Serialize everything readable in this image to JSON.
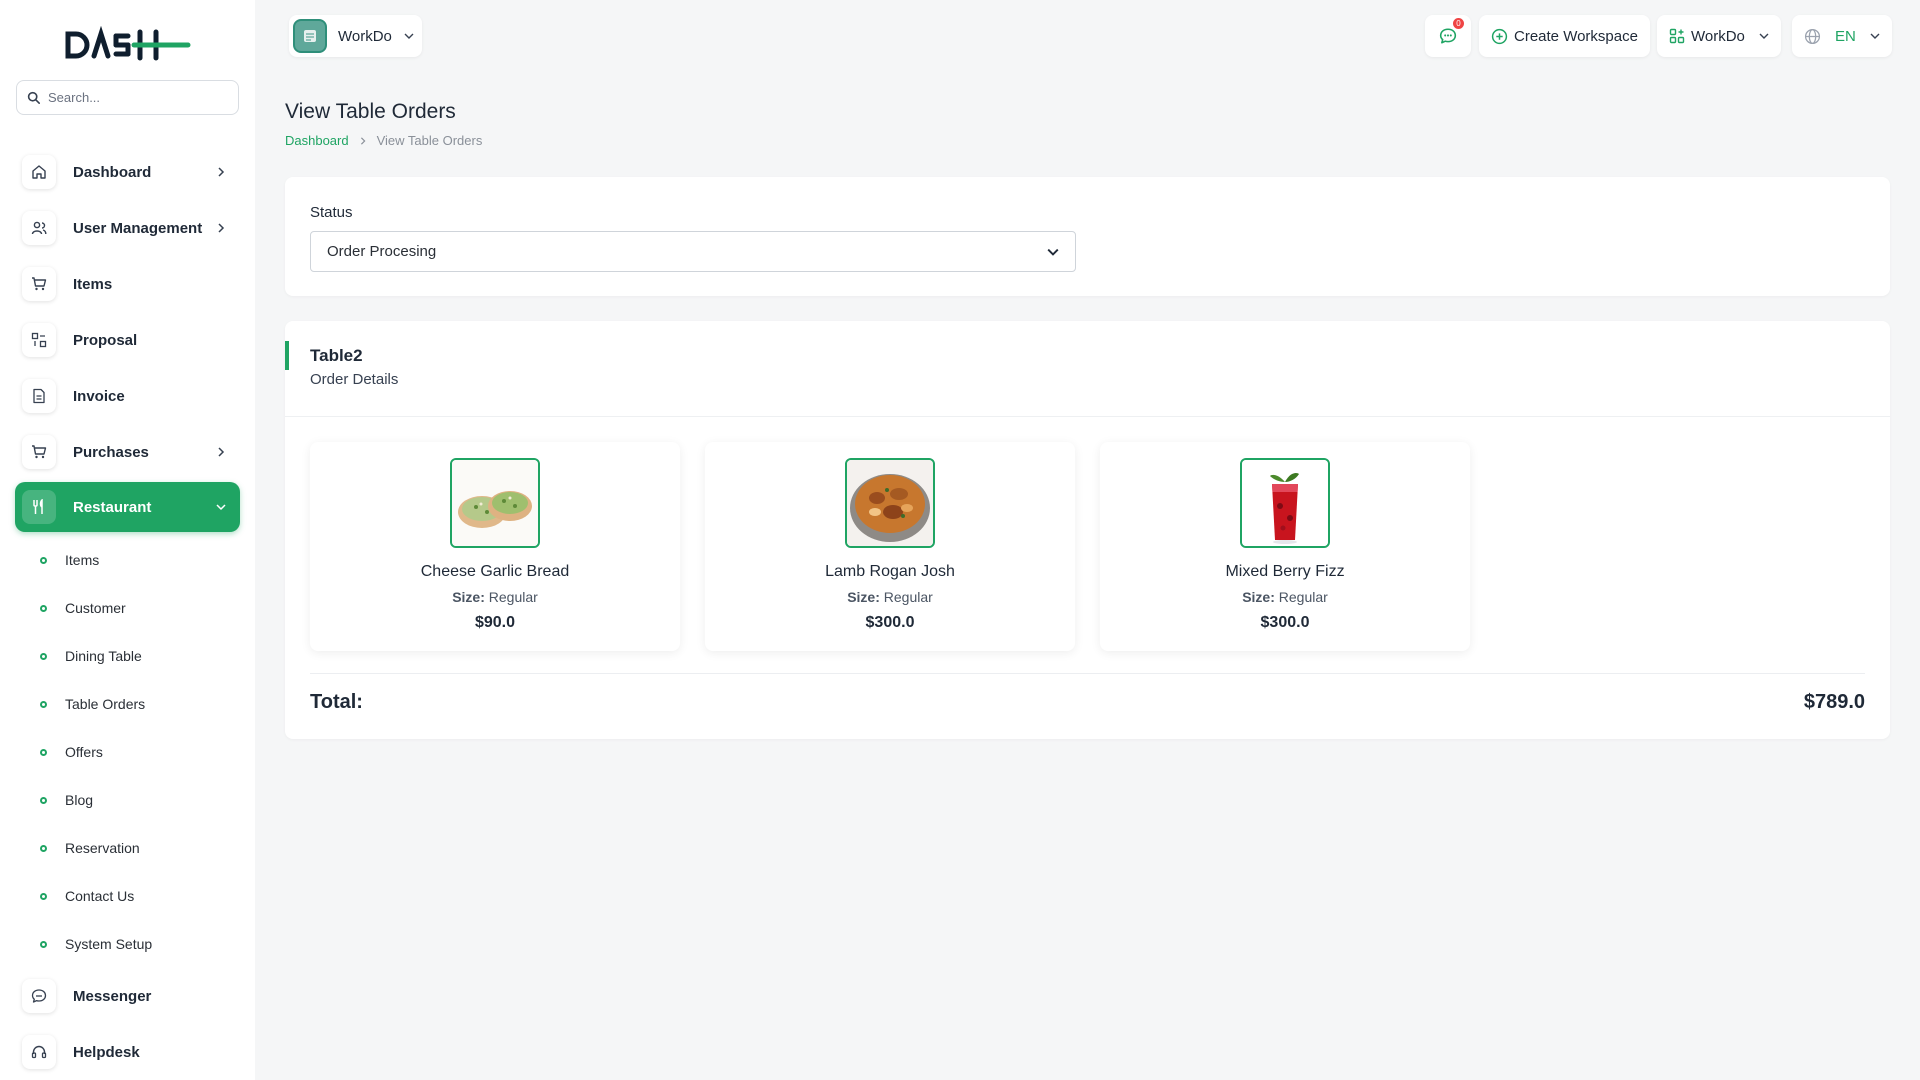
{
  "brand": {
    "logo_text": "DASH",
    "accent": "#1fa463"
  },
  "search": {
    "placeholder": "Search..."
  },
  "sidebar": {
    "items": [
      {
        "label": "Dashboard",
        "icon": "home-icon",
        "expandable": true
      },
      {
        "label": "User Management",
        "icon": "users-icon",
        "expandable": true
      },
      {
        "label": "Items",
        "icon": "cart-icon",
        "expandable": false
      },
      {
        "label": "Proposal",
        "icon": "proposal-icon",
        "expandable": false
      },
      {
        "label": "Invoice",
        "icon": "invoice-icon",
        "expandable": false
      },
      {
        "label": "Purchases",
        "icon": "cart-icon",
        "expandable": true
      },
      {
        "label": "Restaurant",
        "icon": "utensils-icon",
        "expandable": true,
        "active": true
      }
    ],
    "restaurant_sub": [
      {
        "label": "Items"
      },
      {
        "label": "Customer"
      },
      {
        "label": "Dining Table"
      },
      {
        "label": "Table Orders"
      },
      {
        "label": "Offers"
      },
      {
        "label": "Blog"
      },
      {
        "label": "Reservation"
      },
      {
        "label": "Contact Us"
      },
      {
        "label": "System Setup"
      }
    ],
    "bottom_items": [
      {
        "label": "Messenger",
        "icon": "chat-icon"
      },
      {
        "label": "Helpdesk",
        "icon": "headset-icon"
      }
    ]
  },
  "topbar": {
    "workspace": "WorkDo",
    "notifications": "0",
    "create_workspace": "Create Workspace",
    "user_workspace": "WorkDo",
    "language": "EN"
  },
  "page": {
    "title": "View Table Orders",
    "breadcrumb": [
      "Dashboard",
      "View Table Orders"
    ]
  },
  "status": {
    "label": "Status",
    "selected": "Order Procesing"
  },
  "order": {
    "table": "Table2",
    "subtitle": "Order Details",
    "size_label": "Size:",
    "items": [
      {
        "name": "Cheese Garlic Bread",
        "size": "Regular",
        "price": "$90.0"
      },
      {
        "name": "Lamb Rogan Josh",
        "size": "Regular",
        "price": "$300.0"
      },
      {
        "name": "Mixed Berry Fizz",
        "size": "Regular",
        "price": "$300.0"
      }
    ],
    "total_label": "Total:",
    "total_value": "$789.0"
  }
}
